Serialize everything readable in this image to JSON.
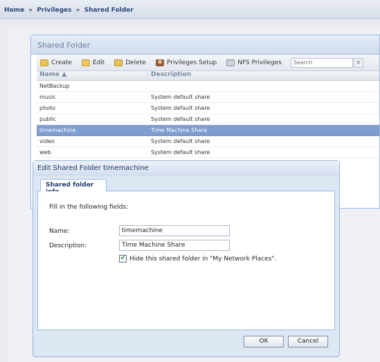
{
  "breadcrumb": {
    "items": [
      "Home",
      "»",
      "Privileges",
      "»",
      "Shared Folder"
    ]
  },
  "panel": {
    "title": "Shared Folder",
    "toolbar": {
      "create": "Create",
      "edit": "Edit",
      "delete": "Delete",
      "privileges_setup": "Privileges Setup",
      "nfs_privileges": "NFS Privileges",
      "search_placeholder": "Search",
      "search_clear": "×"
    },
    "grid": {
      "columns": [
        "Name ▲",
        "Description"
      ],
      "rows": [
        {
          "name": "NetBackup",
          "description": ""
        },
        {
          "name": "music",
          "description": "System default share"
        },
        {
          "name": "photo",
          "description": "System default share"
        },
        {
          "name": "public",
          "description": "System default share"
        },
        {
          "name": "timemachine",
          "description": "Time Machine Share"
        },
        {
          "name": "video",
          "description": "System default share"
        },
        {
          "name": "web",
          "description": "System default share"
        }
      ],
      "selected_row": "timemachine"
    }
  },
  "dialog": {
    "title": "Edit Shared Folder timemachine",
    "tab": "Shared folder info",
    "hint": "Fill in the following fields:",
    "name_label": "Name:",
    "name_value": "timemachine",
    "description_label": "Description:",
    "description_value": "Time Machine Share",
    "hide_label": "Hide this shared folder in \"My Network Places\".",
    "hide_checked": true,
    "check_mark": "✔",
    "ok": "OK",
    "cancel": "Cancel"
  },
  "colors": {
    "selected_row": "#7f9ed0",
    "panel_border": "#99bbe8",
    "breadcrumb_text": "#2c4a7a"
  }
}
